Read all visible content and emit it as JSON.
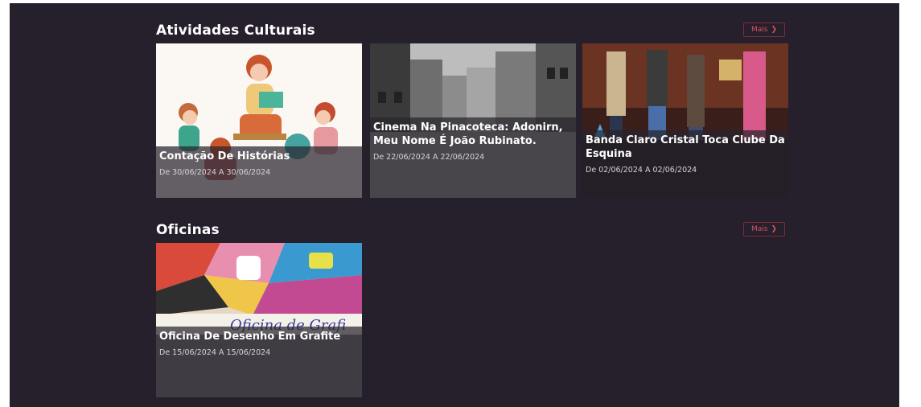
{
  "sections": [
    {
      "title": "Atividades Culturais",
      "more_label": "Mais",
      "cards": [
        {
          "title": "Contação De Histórias",
          "dates": "De 30/06/2024 A 30/06/2024"
        },
        {
          "title": "Cinema Na Pinacoteca: Adonirn, Meu Nome É João Rubinato.",
          "dates": "De 22/06/2024 A 22/06/2024"
        },
        {
          "title": "Banda Claro Cristal Toca Clube Da Esquina",
          "dates": "De 02/06/2024 A 02/06/2024"
        }
      ]
    },
    {
      "title": "Oficinas",
      "more_label": "Mais",
      "cards": [
        {
          "title": "Oficina De Desenho Em Grafite",
          "dates": "De 15/06/2024 A 15/06/2024",
          "image_text": "Oficina de Grafi"
        }
      ]
    }
  ],
  "colors": {
    "background": "#261f2c",
    "accent": "#d8545f"
  },
  "icons": {
    "more": "chevron-right-icon"
  }
}
